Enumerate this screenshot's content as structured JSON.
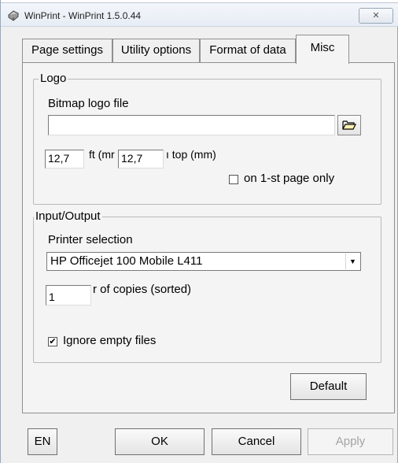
{
  "window": {
    "title": "WinPrint - WinPrint 1.5.0.44",
    "close_label": "✕"
  },
  "tabs": [
    {
      "label": "Page settings",
      "active": false
    },
    {
      "label": "Utility options",
      "active": false
    },
    {
      "label": "Format of data",
      "active": false
    },
    {
      "label": "Misc",
      "active": true
    }
  ],
  "logo": {
    "group_label": "Logo",
    "bitmap_label": "Bitmap logo file",
    "bitmap_value": "",
    "left_value": "12,7",
    "left_label": "ft (mr",
    "top_value": "12,7",
    "top_label": "ı top (mm)",
    "first_page_only_label": "on 1-st page only",
    "first_page_only_checked": false
  },
  "io": {
    "group_label": "Input/Output",
    "printer_label": "Printer selection",
    "printer_value": "HP Officejet 100 Mobile L411",
    "copies_value": "1",
    "copies_label": "r of copies (sorted)",
    "ignore_empty_label": "Ignore empty files",
    "ignore_empty_checked": true
  },
  "default_label": "Default",
  "footer": {
    "lang_label": "EN",
    "ok_label": "OK",
    "cancel_label": "Cancel",
    "apply_label": "Apply"
  },
  "icons": {
    "app": "printer-icon",
    "browse": "folder-open-icon",
    "dropdown": "chevron-down-icon",
    "check_mark": "✔"
  }
}
